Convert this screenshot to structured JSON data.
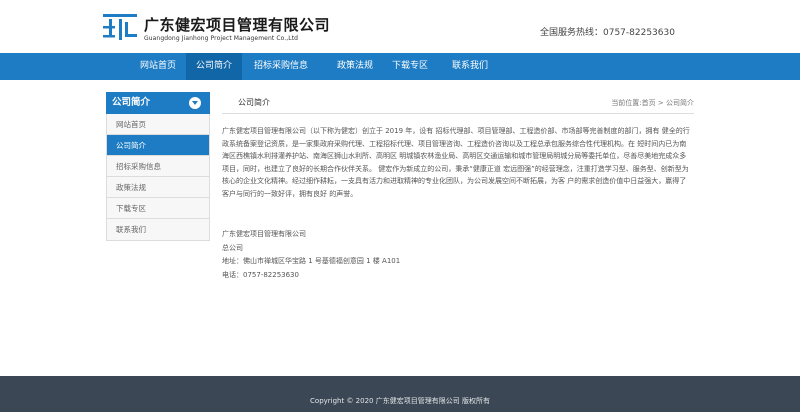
{
  "header": {
    "company_cn": "广东健宏项目管理有限公司",
    "company_en": "Guangdong Jianhong Project Management Co.,Ltd",
    "hotline": "全国服务热线：0757-82253630"
  },
  "nav": {
    "items": [
      {
        "label": "网站首页"
      },
      {
        "label": "公司简介"
      },
      {
        "label": "招标采购信息"
      },
      {
        "label": "政策法规"
      },
      {
        "label": "下载专区"
      },
      {
        "label": "联系我们"
      }
    ],
    "active_index": 1
  },
  "sidebar": {
    "title": "公司简介",
    "items": [
      {
        "label": "网站首页"
      },
      {
        "label": "公司简介"
      },
      {
        "label": "招标采购信息"
      },
      {
        "label": "政策法规"
      },
      {
        "label": "下载专区"
      },
      {
        "label": "联系我们"
      }
    ],
    "active_index": 1
  },
  "content": {
    "section_title": "公司简介",
    "breadcrumb": "当前位置:首页 > 公司简介",
    "paragraph": "广东健宏项目管理有限公司（以下称为健宏）创立于 2019 年，设有 招标代理部、项目管理部、工程造价部、市场部等完善制度的部门，拥有 健全的行政系统备案登记资质，是一家集政府采购代理、工程招标代理、项目管理咨询、工程造价咨询以及工程总承包服务综合性代理机构。在 短时间内已为南海区西樵镇水利排灌养护站、南海区狮山水利所、高明区 明城镇农林渔业局、高明区交通运输和城市管理局明城分局等委托单位，尽善尽美地完成众多项目，同时，也建立了良好的长期合作伙伴关系。 健宏作为新成立的公司，秉承“健康正道 宏远图强”的经营理念，注重打造学习型、服务型、创新型为核心的企业文化精神。经过细作耕耘，一支具有活力和进取精神的专业化团队，为公司发展空间不断拓展，为客 户的需求创造价值中日益强大，赢得了客户与同行的一致好评，拥有良好 的声誉。",
    "contact": {
      "company": "广东健宏项目管理有限公司",
      "office": "总公司",
      "address": "地址：佛山市禅城区华宝路 1 号基德福创意园 1 楼 A101",
      "phone": "电话：0757-82253630"
    }
  },
  "footer": {
    "copyright": "Copyright © 2020 广东健宏项目管理有限公司 版权所有"
  },
  "colors": {
    "brand_blue": "#1d7cc4",
    "nav_active": "#1166a8",
    "footer_bg": "#3b4754"
  }
}
